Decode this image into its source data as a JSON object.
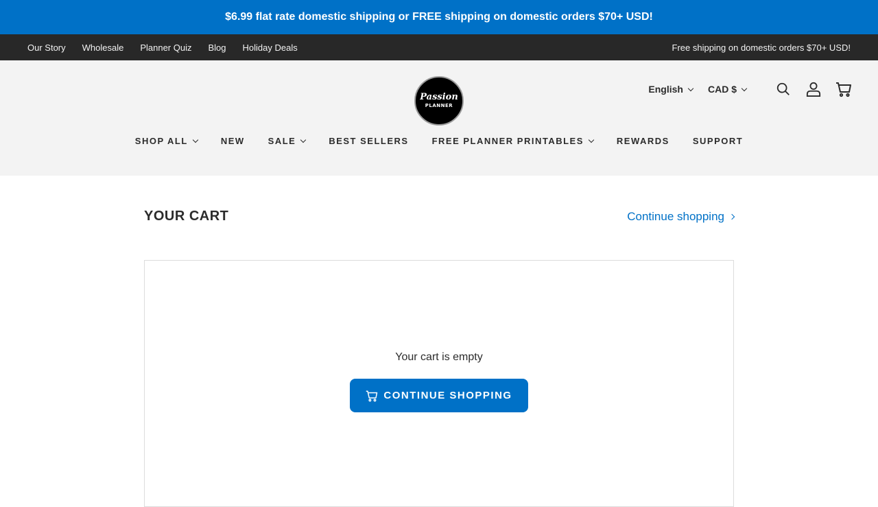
{
  "announcement": "$6.99 flat rate domestic shipping or FREE shipping on domestic orders $70+ USD!",
  "utility_nav": {
    "links": [
      "Our Story",
      "Wholesale",
      "Planner Quiz",
      "Blog",
      "Holiday Deals"
    ],
    "message": "Free shipping on domestic orders $70+ USD!"
  },
  "logo": {
    "line1": "Passion",
    "line2": "PLANNER"
  },
  "selectors": {
    "language": "English",
    "currency": "CAD $"
  },
  "icons": {
    "search": "search-icon",
    "account": "account-icon",
    "cart": "cart-icon"
  },
  "main_nav": [
    {
      "label": "SHOP ALL",
      "dropdown": true
    },
    {
      "label": "NEW",
      "dropdown": false
    },
    {
      "label": "SALE",
      "dropdown": true
    },
    {
      "label": "BEST SELLERS",
      "dropdown": false
    },
    {
      "label": "FREE PLANNER PRINTABLES",
      "dropdown": true
    },
    {
      "label": "REWARDS",
      "dropdown": false
    },
    {
      "label": "SUPPORT",
      "dropdown": false
    }
  ],
  "cart": {
    "title": "YOUR CART",
    "continue_link": "Continue shopping",
    "empty_message": "Your cart is empty",
    "cta_label": "CONTINUE SHOPPING"
  },
  "colors": {
    "brand_blue": "#0071c7",
    "utility_bg": "#282828",
    "header_bg": "#f3f3f3"
  }
}
